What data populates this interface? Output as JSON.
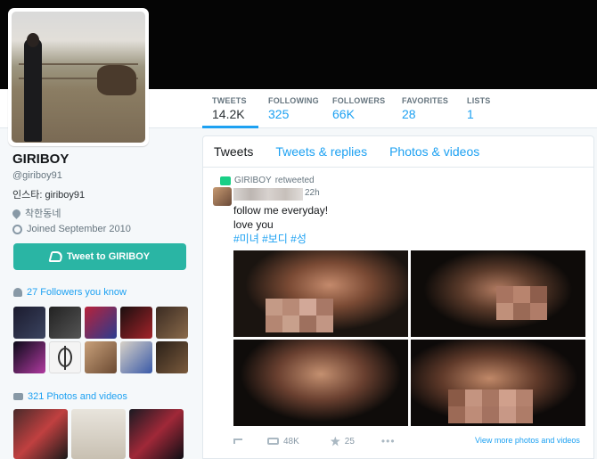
{
  "profile": {
    "name": "GIRIBOY",
    "handle": "@giriboy91",
    "bio": "인스타: giriboy91",
    "location": "착한동네",
    "joined": "Joined September 2010",
    "tweet_to_label": "Tweet to GIRIBOY"
  },
  "stats": [
    {
      "label": "TWEETS",
      "value": "14.2K"
    },
    {
      "label": "FOLLOWING",
      "value": "325"
    },
    {
      "label": "FOLLOWERS",
      "value": "66K"
    },
    {
      "label": "FAVORITES",
      "value": "28"
    },
    {
      "label": "LISTS",
      "value": "1"
    }
  ],
  "sidebar": {
    "followers_you_know": "27 Followers you know",
    "photos_and_videos": "321 Photos and videos"
  },
  "timeline": {
    "tabs": [
      "Tweets",
      "Tweets & replies",
      "Photos & videos"
    ],
    "tweet": {
      "retweeted_by": "GIRIBOY",
      "retweeted_label": "retweeted",
      "time": "22h",
      "line1": "follow me everyday!",
      "line2": "love you",
      "hashtags": "#미녀 #보디 #성",
      "retweet_count": "48K",
      "favorite_count": "25",
      "view_more": "View more photos and videos"
    }
  },
  "colors": {
    "accent": "#1da1f2",
    "button": "#2ab5a4",
    "banner": "#050505"
  }
}
